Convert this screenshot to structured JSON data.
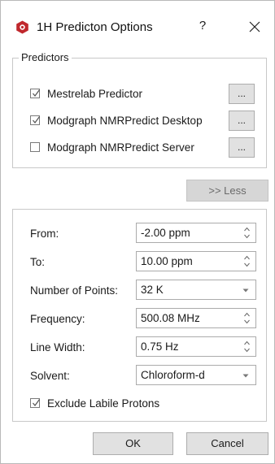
{
  "window": {
    "title": "1H Predicton Options",
    "help_label": "?",
    "icon": "mestrenova-app-icon"
  },
  "predictors": {
    "legend": "Predictors",
    "items": [
      {
        "label": "Mestrelab Predictor",
        "checked": true,
        "button_label": "..."
      },
      {
        "label": "Modgraph NMRPredict Desktop",
        "checked": true,
        "button_label": "..."
      },
      {
        "label": "Modgraph NMRPredict Server",
        "checked": false,
        "button_label": "..."
      }
    ]
  },
  "less_button": ">> Less",
  "options": {
    "from": {
      "label": "From:",
      "value": "-2.00 ppm"
    },
    "to": {
      "label": "To:",
      "value": "10.00 ppm"
    },
    "points": {
      "label": "Number of Points:",
      "value": "32 K"
    },
    "frequency": {
      "label": "Frequency:",
      "value": "500.08 MHz"
    },
    "line_width": {
      "label": "Line Width:",
      "value": "0.75 Hz"
    },
    "solvent": {
      "label": "Solvent:",
      "value": "Chloroform-d"
    },
    "exclude_labile": {
      "label": "Exclude Labile Protons",
      "checked": true
    }
  },
  "footer": {
    "ok": "OK",
    "cancel": "Cancel"
  },
  "colors": {
    "icon_red": "#c0282d",
    "button_face": "#e1e1e1",
    "disabled_text": "#6a6a6a"
  }
}
